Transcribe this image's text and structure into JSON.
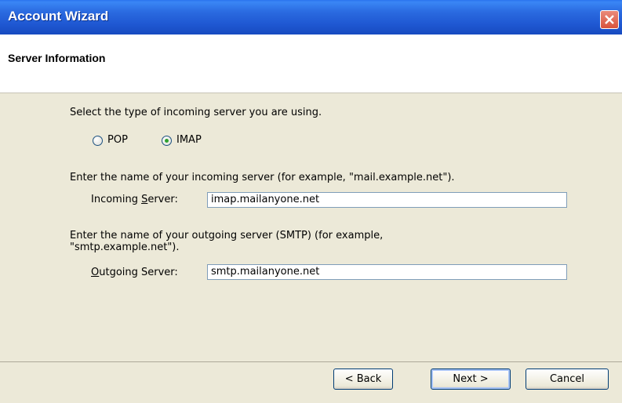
{
  "window": {
    "title": "Account Wizard"
  },
  "header": {
    "title": "Server Information"
  },
  "server_type": {
    "prompt": "Select the type of incoming server you are using.",
    "options": [
      {
        "label": "POP",
        "selected": false
      },
      {
        "label": "IMAP",
        "selected": true
      }
    ]
  },
  "incoming": {
    "prompt": "Enter the name of your incoming server (for example, \"mail.example.net\").",
    "label_prefix": "Incoming ",
    "label_access": "S",
    "label_suffix": "erver:",
    "value": "imap.mailanyone.net"
  },
  "outgoing": {
    "prompt_line1": "Enter the name of your outgoing server (SMTP) (for example,",
    "prompt_line2": "\"smtp.example.net\").",
    "label_access": "O",
    "label_suffix": "utgoing Server:",
    "value": "smtp.mailanyone.net"
  },
  "buttons": {
    "back": "< Back",
    "next": "Next >",
    "cancel": "Cancel"
  },
  "colors": {
    "titlebar": "#1f58d2",
    "close": "#d8543d",
    "face": "#ece9d8",
    "radio_dot": "#2fa02f"
  }
}
